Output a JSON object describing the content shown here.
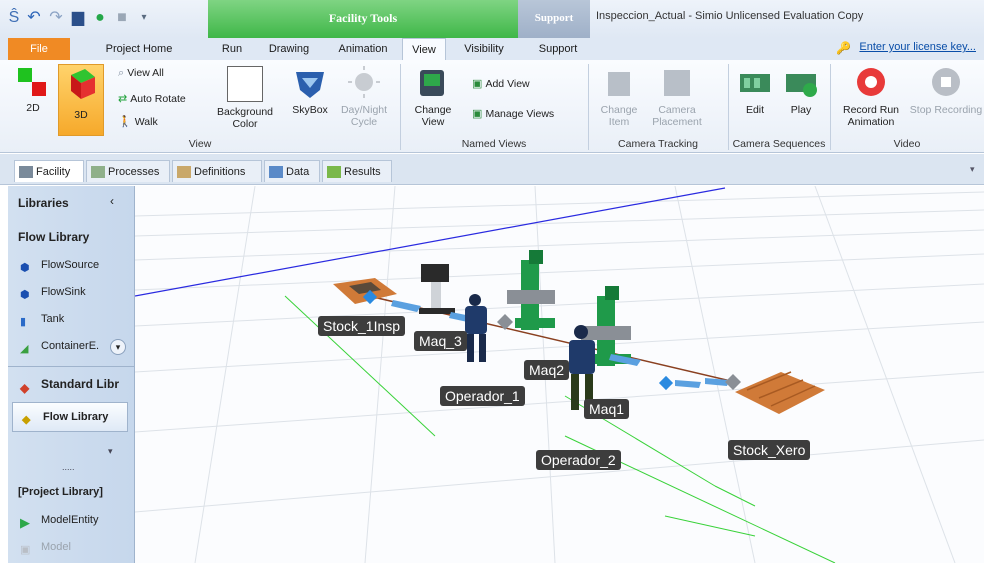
{
  "window": {
    "title": "Inspeccion_Actual - Simio Unlicensed Evaluation Copy",
    "context_tab_facility_tools": "Facility Tools",
    "context_tab_support": "Support"
  },
  "tabs": [
    "File",
    "Project Home",
    "Run",
    "Drawing",
    "Animation",
    "View",
    "Visibility",
    "Support"
  ],
  "active_tab": "View",
  "license_link": "Enter your license key...",
  "ribbon": {
    "view_group": {
      "label": "View",
      "btn_2d": "2D",
      "btn_3d": "3D",
      "view_all": "View All",
      "auto_rotate": "Auto Rotate",
      "walk": "Walk",
      "background_color": "Background Color",
      "skybox": "SkyBox",
      "day_night": "Day/Night Cycle"
    },
    "named_views": {
      "label": "Named Views",
      "change_view": "Change View",
      "add_view": "Add View",
      "manage_views": "Manage Views"
    },
    "camera_tracking": {
      "label": "Camera Tracking",
      "change_item": "Change Item",
      "camera_placement": "Camera Placement"
    },
    "camera_sequences": {
      "label": "Camera Sequences",
      "edit": "Edit",
      "play": "Play"
    },
    "video": {
      "label": "Video",
      "record": "Record Run Animation",
      "stop": "Stop Recording"
    }
  },
  "doc_tabs": [
    "Facility",
    "Processes",
    "Definitions",
    "Data",
    "Results"
  ],
  "sidebar": {
    "libraries": "Libraries",
    "flow_library_header": "Flow Library",
    "flow_items": [
      "FlowSource",
      "FlowSink",
      "Tank",
      "ContainerE."
    ],
    "standard_library": "Standard Libr",
    "flow_library_button": "Flow Library",
    "dots": ".....",
    "project_library": "[Project Library]",
    "project_items": [
      "ModelEntity",
      "Model"
    ]
  },
  "scene_labels": {
    "stock_insp": "Stock_1Insp",
    "maq3": "Maq_3",
    "maq2": "Maq2",
    "operador1": "Operador_1",
    "maq1": "Maq1",
    "operador2": "Operador_2",
    "stock_xero": "Stock_Xero"
  },
  "colors": {
    "file_tab": "#f08a24",
    "facility_tools": "#3fb748",
    "machine_green": "#1f9a4a",
    "sidebar_bg": "#c6d7ec"
  }
}
